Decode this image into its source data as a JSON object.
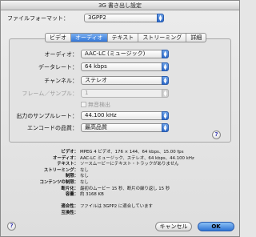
{
  "window": {
    "title": "3G 書き出し設定"
  },
  "format": {
    "label": "ファイルフォーマット：",
    "value": "3GPP2"
  },
  "tabs": [
    {
      "label": "ビデオ"
    },
    {
      "label": "オーディオ"
    },
    {
      "label": "テキスト"
    },
    {
      "label": "ストリーミング"
    },
    {
      "label": "詳細"
    }
  ],
  "audio": {
    "audio_label": "オーディオ：",
    "audio_value": "AAC-LC (ミュージック)",
    "datarate_label": "データレート：",
    "datarate_value": "64 kbps",
    "channel_label": "チャンネル：",
    "channel_value": "ステレオ",
    "frames_label": "フレーム／サンプル：",
    "frames_value": "1",
    "silence_label": "無音検出",
    "samplerate_label": "出力のサンプルレート：",
    "samplerate_value": "44.100 kHz",
    "quality_label": "エンコードの品質：",
    "quality_value": "最高品質"
  },
  "summary": [
    {
      "label": "ビデオ：",
      "value": "MPEG 4 ビデオ、176 × 144、64 kbps、15.00 fps"
    },
    {
      "label": "オーディオ：",
      "value": "AAC-LC ミュージック、ステレオ、64 kbps、44.100 kHz"
    },
    {
      "label": "テキスト：",
      "value": "ソースムービーにテキスト・トラックがありません"
    },
    {
      "label": "ストリーミング：",
      "value": "なし"
    },
    {
      "label": "制限：",
      "value": "なし"
    },
    {
      "label": "コンテンツの制限：",
      "value": "なし"
    },
    {
      "label": "断片化：",
      "value": "最初のムービー 15 秒、断片の繰り返し 15 秒"
    },
    {
      "label": "容量：",
      "value": "約 3168 KB"
    },
    {
      "label": "",
      "value": ""
    },
    {
      "label": "適合性：",
      "value": "ファイルは 3GPP2 に適合しています"
    },
    {
      "label": "互換性：",
      "value": ""
    }
  ],
  "buttons": {
    "cancel": "キャンセル",
    "ok": "OK",
    "help": "?"
  }
}
